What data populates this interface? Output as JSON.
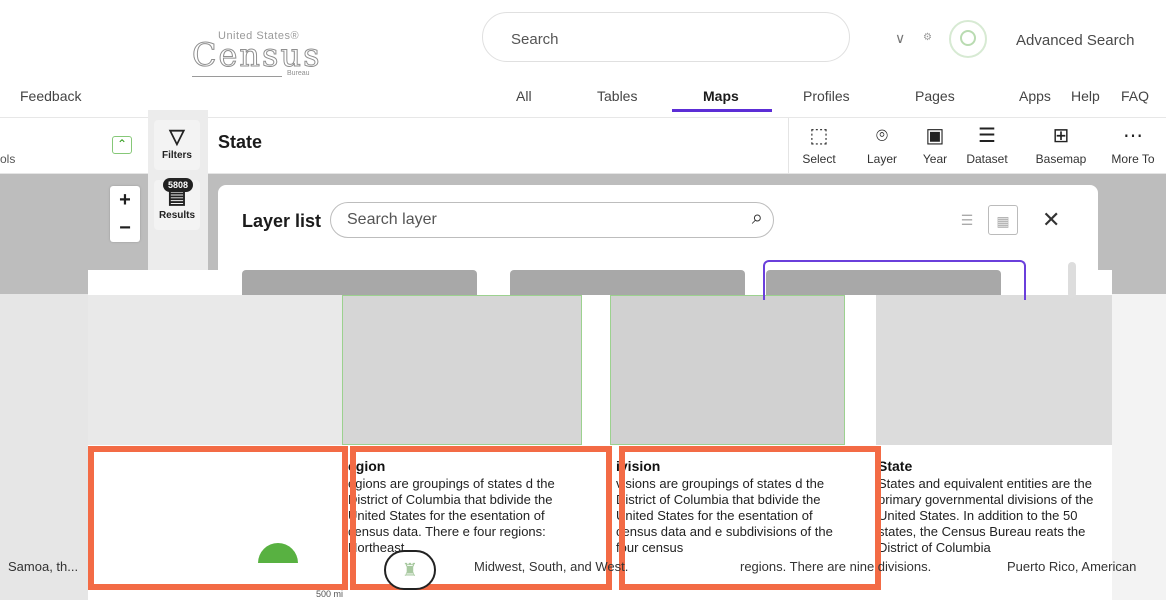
{
  "header": {
    "logo_top": "United States®",
    "logo_word": "Census",
    "logo_bureau": "Bureau",
    "search_text": "Search",
    "advanced_search": "Advanced Search"
  },
  "nav": {
    "feedback": "Feedback",
    "tabs": [
      "All",
      "Tables",
      "Maps",
      "Profiles",
      "Pages",
      "Apps",
      "Help",
      "FAQ"
    ],
    "active": "Maps"
  },
  "toolbar": {
    "tools_label": "ols",
    "title": "State",
    "buttons": [
      {
        "label": "Select",
        "icon": "select-icon"
      },
      {
        "label": "Layer",
        "icon": "layer-icon"
      },
      {
        "label": "Year",
        "icon": "calendar-icon"
      },
      {
        "label": "Dataset",
        "icon": "dataset-icon"
      },
      {
        "label": "Basemap",
        "icon": "grid-icon"
      },
      {
        "label": "More To",
        "icon": "more-icon"
      }
    ]
  },
  "rail": {
    "filters": "Filters",
    "results": "Results",
    "results_count": "5808"
  },
  "panel": {
    "title": "Layer list",
    "search_placeholder": "Search layer",
    "cards": [
      {
        "name": "",
        "desc": ""
      },
      {
        "name": "egion",
        "desc": "egions are groupings of states d the District of Columbia that bdivide the United States for the esentation of census data. There e four regions: Northeast"
      },
      {
        "name": "ivision",
        "desc": "visions are groupings of states d the District of Columbia that bdivide the United States for the esentation of census data and e subdivisions of the four census"
      },
      {
        "name": "State",
        "desc": "States and equivalent entities are the primary governmental divisions of the United States. In addition to the 50 states, the Census Bureau reats the District of Columbia"
      }
    ]
  },
  "bottom": {
    "samoa": "Samoa, th...",
    "midwest": "Midwest, South, and West.",
    "regions": "regions. There are nine divisions.",
    "puerto": "Puerto Rico, American",
    "scale": "500 mi"
  },
  "colors": {
    "accent": "#5c2dd6",
    "highlight": "#f36b45",
    "green": "#58b141"
  }
}
